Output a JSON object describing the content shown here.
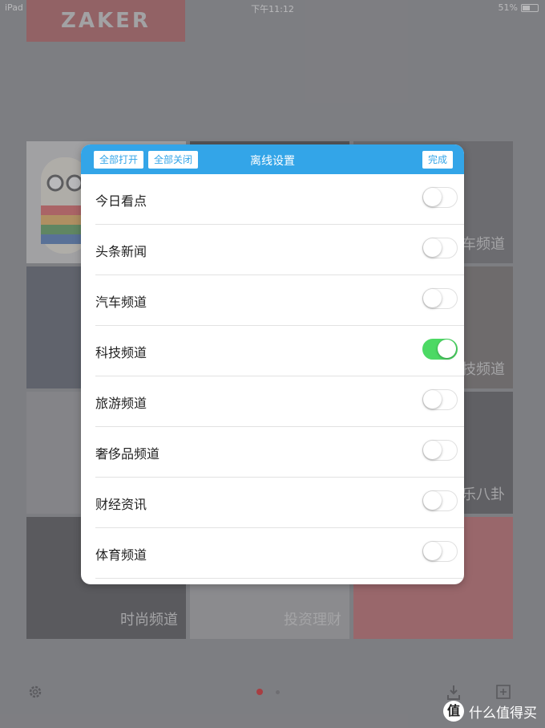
{
  "status_bar": {
    "device": "iPad",
    "time": "下午11:12",
    "battery": "51%",
    "battery_level": 0.51
  },
  "app": {
    "logo": "ZAKER"
  },
  "tiles": [
    {
      "label": ""
    },
    {
      "label": ""
    },
    {
      "label": "车频道"
    },
    {
      "label": ""
    },
    {
      "label": ""
    },
    {
      "label": "科技频道"
    },
    {
      "label": ""
    },
    {
      "label": ""
    },
    {
      "label": "乐八卦"
    },
    {
      "label": "时尚频道"
    },
    {
      "label": "投资理财"
    },
    {
      "label": ""
    }
  ],
  "bottom_bar": {
    "icons": [
      "settings-gear-icon",
      "download-icon",
      "add-icon"
    ],
    "page_count": 2,
    "active_page": 1
  },
  "modal": {
    "title": "离线设置",
    "open_all": "全部打开",
    "close_all": "全部关闭",
    "done": "完成",
    "channels": [
      {
        "label": "今日看点",
        "enabled": false
      },
      {
        "label": "头条新闻",
        "enabled": false
      },
      {
        "label": "汽车频道",
        "enabled": false
      },
      {
        "label": "科技频道",
        "enabled": true
      },
      {
        "label": "旅游频道",
        "enabled": false
      },
      {
        "label": "奢侈品频道",
        "enabled": false
      },
      {
        "label": "财经资讯",
        "enabled": false
      },
      {
        "label": "体育频道",
        "enabled": false
      }
    ]
  },
  "watermark": {
    "badge": "值",
    "text": "什么值得买"
  },
  "colors": {
    "header_blue": "#33a5e8",
    "toggle_on": "#4cd964",
    "brand_red": "#a83e42"
  }
}
